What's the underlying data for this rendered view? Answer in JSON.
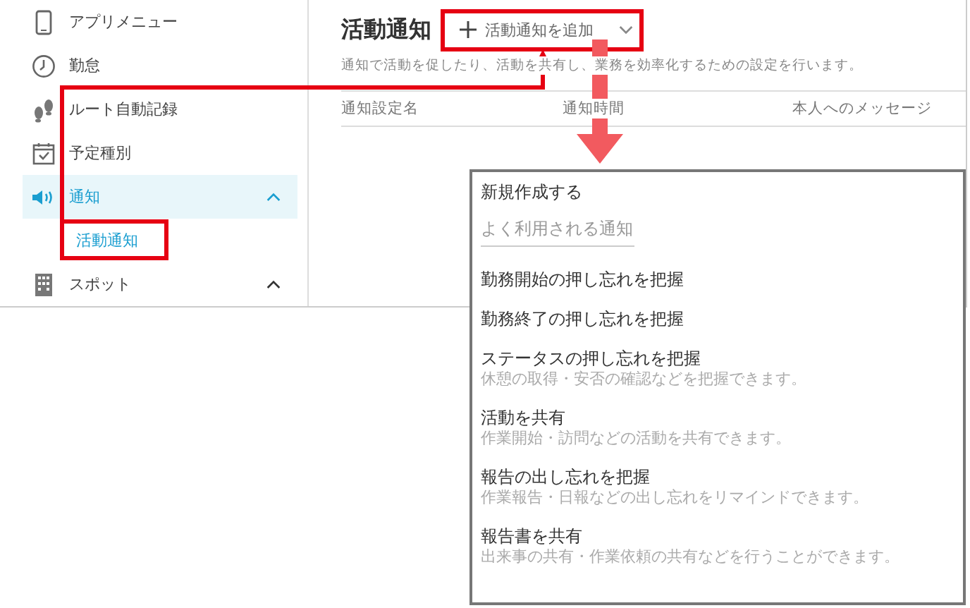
{
  "sidebar": {
    "items": [
      {
        "label": "アプリメニュー",
        "kind": "link",
        "selected": false
      },
      {
        "label": "勤怠",
        "kind": "link",
        "selected": false
      },
      {
        "label": "ルート自動記録",
        "kind": "link",
        "selected": false
      },
      {
        "label": "予定種別",
        "kind": "link",
        "selected": false
      },
      {
        "label": "通知",
        "kind": "group",
        "selected": true,
        "expanded": true,
        "children": [
          {
            "label": "活動通知",
            "selected": true
          }
        ]
      },
      {
        "label": "スポット",
        "kind": "group",
        "selected": false,
        "expanded": true
      }
    ]
  },
  "main": {
    "title": "活動通知",
    "add_button": "活動通知を追加",
    "description": "通知で活動を促したり、活動を共有し、業務を効率化するための設定を行います。",
    "table": {
      "columns": [
        "通知設定名",
        "通知時間",
        "本人へのメッセージ"
      ]
    }
  },
  "dropdown": {
    "items": [
      {
        "kind": "action",
        "label": "新規作成する"
      },
      {
        "kind": "heading",
        "label": "よく利用される通知"
      },
      {
        "kind": "option",
        "label": "勤務開始の押し忘れを把握"
      },
      {
        "kind": "option",
        "label": "勤務終了の押し忘れを把握"
      },
      {
        "kind": "option",
        "label": "ステータスの押し忘れを把握",
        "description": "休憩の取得・安否の確認などを把握できます。"
      },
      {
        "kind": "option",
        "label": "活動を共有",
        "description": "作業開始・訪問などの活動を共有できます。"
      },
      {
        "kind": "option",
        "label": "報告の出し忘れを把握",
        "description": "作業報告・日報などの出し忘れをリマインドできます。"
      },
      {
        "kind": "option",
        "label": "報告書を共有",
        "description": "出来事の共有・作業依頼の共有などを行うことができます。"
      }
    ]
  }
}
